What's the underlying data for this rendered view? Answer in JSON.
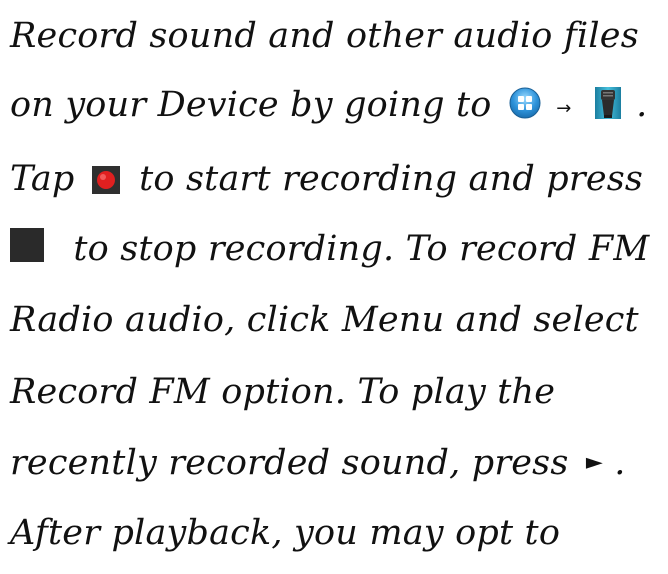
{
  "document": {
    "line1": "Record sound and other audio files",
    "line2_text": "on your Device by going to",
    "line2_period": ".",
    "line3_start": "Tap",
    "line3_end": "to start recording and press",
    "line4_text": "to stop recording. To record FM",
    "line5": "Radio audio, click Menu and select",
    "line6": "Record FM option.  To play the",
    "line7_text": "recently recorded sound, press",
    "line7_period": ".",
    "line8": "After playback, you may opt to"
  },
  "icons": {
    "apps": "apps-icon",
    "arrow": "right-arrow-icon",
    "recorder": "sound-recorder-icon",
    "record": "record-icon",
    "stop": "stop-icon",
    "play": "play-icon"
  },
  "colors": {
    "text": "#111111",
    "record_red": "#e02020",
    "stop_dark": "#2a2a2a",
    "apps_blue": "#3aa0e0"
  }
}
